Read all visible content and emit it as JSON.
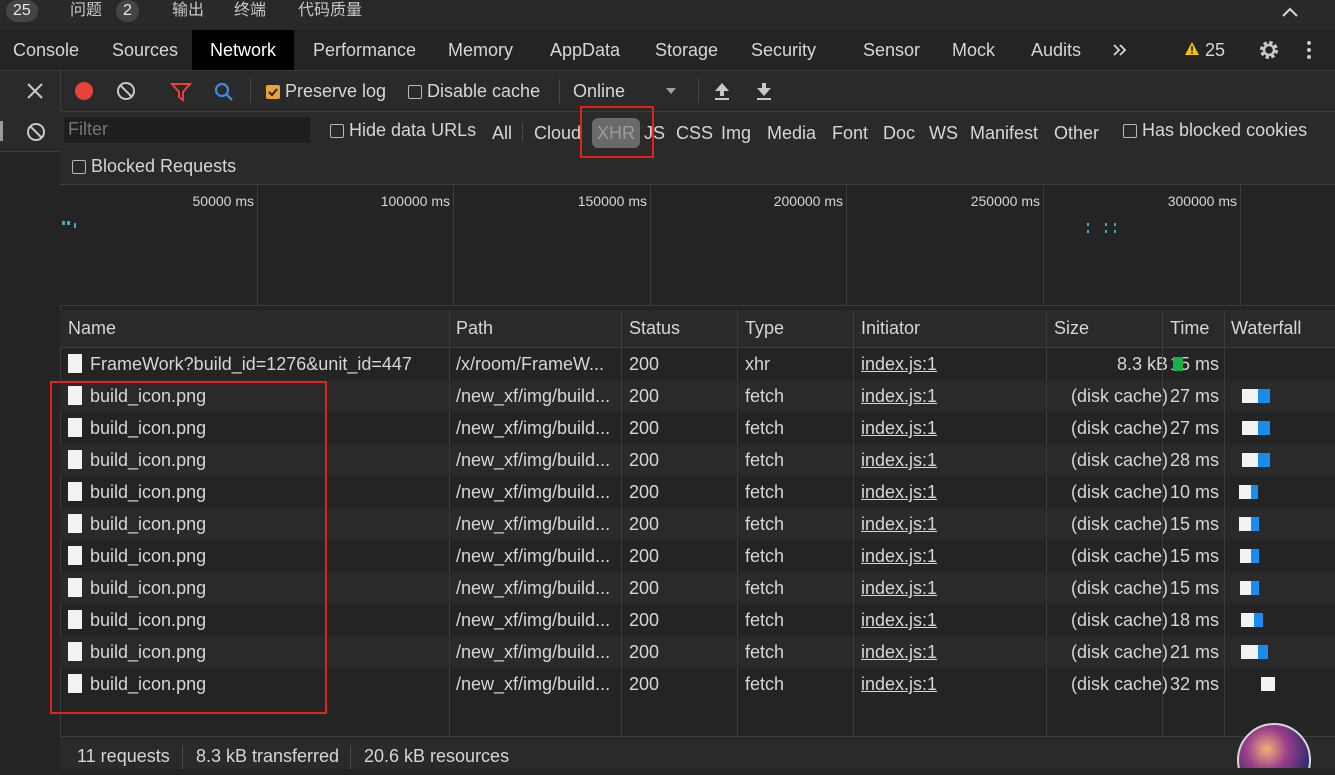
{
  "top": {
    "count_badge": "25",
    "problems_label": "问题",
    "problems_count": "2",
    "output_label": "输出",
    "terminal_label": "终端",
    "quality_label": "代码质量"
  },
  "tabs": [
    "Console",
    "Sources",
    "Network",
    "Performance",
    "Memory",
    "AppData",
    "Storage",
    "Security",
    "Sensor",
    "Mock",
    "Audits"
  ],
  "warnings_count": "25",
  "toolbar": {
    "preserve_log": "Preserve log",
    "disable_cache": "Disable cache",
    "throttle": "Online"
  },
  "filter": {
    "placeholder": "Filter",
    "hide_data_urls": "Hide data URLs",
    "types": [
      "All",
      "Cloud",
      "XHR",
      "JS",
      "CSS",
      "Img",
      "Media",
      "Font",
      "Doc",
      "WS",
      "Manifest",
      "Other"
    ],
    "has_blocked_cookies": "Has blocked cookies",
    "blocked_requests": "Blocked Requests"
  },
  "timeline": {
    "ticks": [
      "50000 ms",
      "100000 ms",
      "150000 ms",
      "200000 ms",
      "250000 ms",
      "300000 ms"
    ]
  },
  "table": {
    "headers": [
      "Name",
      "Path",
      "Status",
      "Type",
      "Initiator",
      "Size",
      "Time",
      "Waterfall"
    ],
    "rows": [
      {
        "name": "FrameWork?build_id=1276&unit_id=447",
        "path": "/x/room/FrameW...",
        "status": "200",
        "type": "xhr",
        "initiator": "index.js:1",
        "size": "8.3 kB",
        "time": "15 ms"
      },
      {
        "name": "build_icon.png",
        "path": "/new_xf/img/build...",
        "status": "200",
        "type": "fetch",
        "initiator": "index.js:1",
        "size": "(disk cache)",
        "time": "27 ms"
      },
      {
        "name": "build_icon.png",
        "path": "/new_xf/img/build...",
        "status": "200",
        "type": "fetch",
        "initiator": "index.js:1",
        "size": "(disk cache)",
        "time": "27 ms"
      },
      {
        "name": "build_icon.png",
        "path": "/new_xf/img/build...",
        "status": "200",
        "type": "fetch",
        "initiator": "index.js:1",
        "size": "(disk cache)",
        "time": "28 ms"
      },
      {
        "name": "build_icon.png",
        "path": "/new_xf/img/build...",
        "status": "200",
        "type": "fetch",
        "initiator": "index.js:1",
        "size": "(disk cache)",
        "time": "10 ms"
      },
      {
        "name": "build_icon.png",
        "path": "/new_xf/img/build...",
        "status": "200",
        "type": "fetch",
        "initiator": "index.js:1",
        "size": "(disk cache)",
        "time": "15 ms"
      },
      {
        "name": "build_icon.png",
        "path": "/new_xf/img/build...",
        "status": "200",
        "type": "fetch",
        "initiator": "index.js:1",
        "size": "(disk cache)",
        "time": "15 ms"
      },
      {
        "name": "build_icon.png",
        "path": "/new_xf/img/build...",
        "status": "200",
        "type": "fetch",
        "initiator": "index.js:1",
        "size": "(disk cache)",
        "time": "15 ms"
      },
      {
        "name": "build_icon.png",
        "path": "/new_xf/img/build...",
        "status": "200",
        "type": "fetch",
        "initiator": "index.js:1",
        "size": "(disk cache)",
        "time": "18 ms"
      },
      {
        "name": "build_icon.png",
        "path": "/new_xf/img/build...",
        "status": "200",
        "type": "fetch",
        "initiator": "index.js:1",
        "size": "(disk cache)",
        "time": "21 ms"
      },
      {
        "name": "build_icon.png",
        "path": "/new_xf/img/build...",
        "status": "200",
        "type": "fetch",
        "initiator": "index.js:1",
        "size": "(disk cache)",
        "time": "32 ms"
      }
    ]
  },
  "status": {
    "requests": "11 requests",
    "transferred": "8.3 kB transferred",
    "resources": "20.6 kB resources"
  },
  "colors": {
    "record": "#e8423b",
    "filter_icon": "#e8423b",
    "search_icon": "#3a8de0",
    "checkbox_on": "#e8a33c",
    "warning": "#f2c100",
    "highlight": "#e0241b",
    "waterfall_blue": "#1a8cf0",
    "waterfall_green": "#19b04a"
  }
}
